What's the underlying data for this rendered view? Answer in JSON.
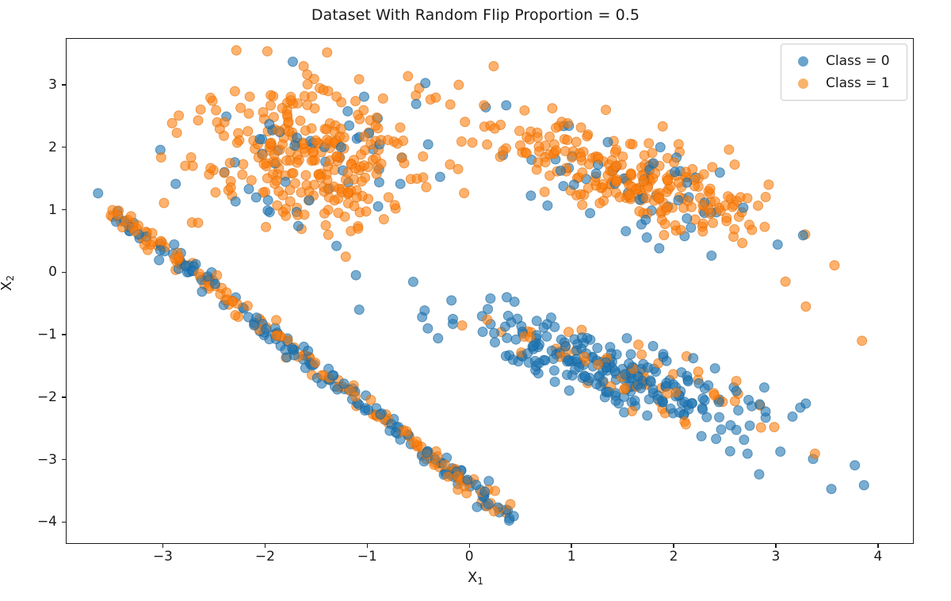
{
  "chart_data": {
    "type": "scatter",
    "title": "Dataset With Random Flip Proportion = 0.5",
    "xlabel": "X₁",
    "ylabel": "X₂",
    "xlabel_base": "X",
    "xlabel_sub": "1",
    "ylabel_base": "X",
    "ylabel_sub": "2",
    "xlim": [
      -3.95,
      4.35
    ],
    "ylim": [
      -4.35,
      3.75
    ],
    "xticks": [
      -3,
      -2,
      -1,
      0,
      1,
      2,
      3,
      4
    ],
    "xtick_labels": [
      "−3",
      "−2",
      "−1",
      "0",
      "1",
      "2",
      "3",
      "4"
    ],
    "yticks": [
      3,
      2,
      1,
      0,
      -1,
      -2,
      -3,
      -4
    ],
    "ytick_labels": [
      "3",
      "2",
      "1",
      "0",
      "−1",
      "−2",
      "−3",
      "−4"
    ],
    "grid": false,
    "legend_position": "upper right",
    "marker": {
      "shape": "circle",
      "radius_px": 6,
      "alpha": 0.6,
      "edge_width": 1.0
    },
    "series": [
      {
        "name": "Class = 0",
        "label": "Class = 0",
        "color": "#1f77b4",
        "edge_color": "#15639a",
        "legend_swatch": "#6aa4cc",
        "n_points": 620
      },
      {
        "name": "Class = 1",
        "label": "Class = 1",
        "color": "#ff7f0e",
        "edge_color": "#e06c00",
        "legend_swatch": "#fab36a",
        "n_points": 620
      }
    ],
    "clusters": [
      {
        "id": "upper-left-blob",
        "shape": "gaussian",
        "cx": -1.55,
        "cy": 1.85,
        "sx": 0.58,
        "sy": 0.62,
        "rot_deg": 0,
        "n": 330,
        "class1_fraction": 0.8
      },
      {
        "id": "diagonal-line",
        "shape": "line",
        "x0": -3.5,
        "y0": 1.0,
        "x1": 0.45,
        "y1": -3.98,
        "thickness": 0.055,
        "n": 300,
        "class1_fraction": 0.48
      },
      {
        "id": "upper-right-band",
        "shape": "gaussian",
        "cx": 1.65,
        "cy": 1.45,
        "sx": 0.8,
        "sy": 0.3,
        "rot_deg": -32,
        "n": 300,
        "class1_fraction": 0.78
      },
      {
        "id": "lower-right-band",
        "shape": "gaussian",
        "cx": 1.45,
        "cy": -1.6,
        "sx": 0.88,
        "sy": 0.22,
        "rot_deg": -32,
        "n": 300,
        "class1_fraction": 0.22
      }
    ],
    "outliers": [
      {
        "x": 3.85,
        "y": -1.1,
        "cls": 1
      },
      {
        "x": 3.55,
        "y": -3.48,
        "cls": 0
      },
      {
        "x": 3.78,
        "y": -3.1,
        "cls": 0
      },
      {
        "x": 3.87,
        "y": -3.42,
        "cls": 0
      },
      {
        "x": -3.5,
        "y": 1.0,
        "cls": 1
      },
      {
        "x": -2.88,
        "y": 1.42,
        "cls": 0
      },
      {
        "x": -1.08,
        "y": -0.6,
        "cls": 0
      },
      {
        "x": 3.05,
        "y": -2.88,
        "cls": 0
      },
      {
        "x": 3.3,
        "y": -0.55,
        "cls": 1
      },
      {
        "x": 3.1,
        "y": -0.15,
        "cls": 1
      },
      {
        "x": -2.72,
        "y": 0.8,
        "cls": 1
      },
      {
        "x": -2.65,
        "y": -0.02,
        "cls": 1
      }
    ]
  },
  "legend": {
    "items": [
      {
        "label": "Class = 0",
        "color": "#6aa4cc"
      },
      {
        "label": "Class = 1",
        "color": "#fab36a"
      }
    ]
  }
}
